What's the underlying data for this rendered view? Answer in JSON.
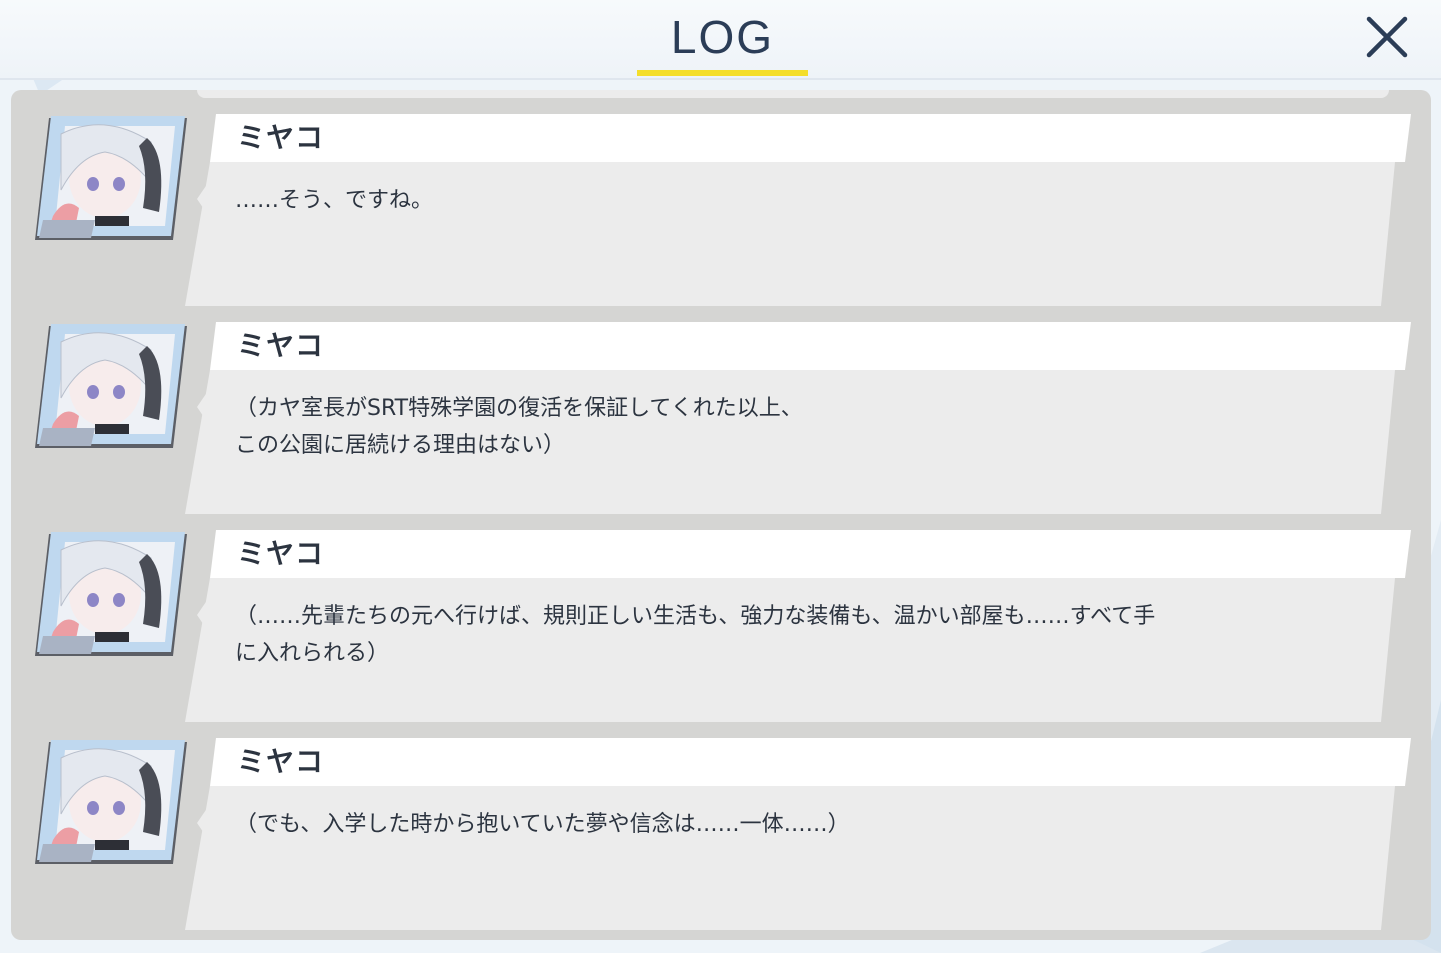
{
  "header": {
    "title": "LOG",
    "close_icon": "close-x-icon"
  },
  "colors": {
    "title_text": "#2b3d57",
    "title_underline": "#f4de2b",
    "panel_bg": "#d5d5d3",
    "bubble_bg": "#ececec",
    "name_strip_bg": "#ffffff",
    "text": "#2c3440"
  },
  "log": {
    "entries": [
      {
        "speaker": "ミヤコ",
        "portrait": "miyako-portrait",
        "text": "……そう、ですね。"
      },
      {
        "speaker": "ミヤコ",
        "portrait": "miyako-portrait",
        "text": "（カヤ室長がSRT特殊学園の復活を保証してくれた以上、\nこの公園に居続ける理由はない）"
      },
      {
        "speaker": "ミヤコ",
        "portrait": "miyako-portrait",
        "text": "（……先輩たちの元へ行けば、規則正しい生活も、強力な装備も、温かい部屋も……すべて手\nに入れられる）"
      },
      {
        "speaker": "ミヤコ",
        "portrait": "miyako-portrait",
        "text": "（でも、入学した時から抱いていた夢や信念は……一体……）"
      }
    ]
  }
}
